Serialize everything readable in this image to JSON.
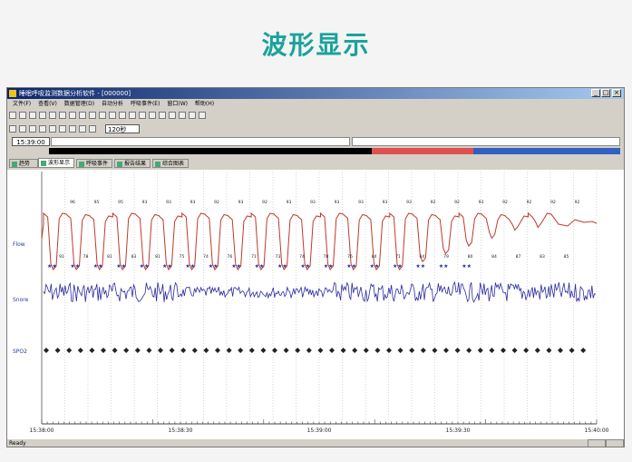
{
  "heading": "波形显示",
  "window": {
    "title": "睡眠呼吸监测数据分析软件 - [000000]",
    "menu": [
      "文件(F)",
      "查看(V)",
      "数据管理(D)",
      "自动分析",
      "呼吸事件(E)",
      "窗口(W)",
      "帮助(H)"
    ],
    "time": "15:39:00",
    "speed": "120秒",
    "tabs": [
      "趋势图",
      "波形显示",
      "呼吸事件",
      "报告结果",
      "综合图表"
    ],
    "active_tab": 1,
    "status": "Ready"
  },
  "channels": [
    "Flow",
    "Snore",
    "SPO2"
  ],
  "spo2_top_values": [
    "96",
    "95",
    "95",
    "93",
    "93",
    "93",
    "92",
    "93",
    "92",
    "93",
    "93",
    "93",
    "93",
    "93",
    "93",
    "92",
    "92",
    "93",
    "92",
    "92",
    "92",
    "92"
  ],
  "spo2_bottom_values": [
    "91",
    "78",
    "81",
    "83",
    "81",
    "75",
    "74",
    "76",
    "71",
    "73",
    "74",
    "78",
    "76",
    "84",
    "71",
    "84",
    "79",
    "80",
    "84",
    "87",
    "83",
    "85"
  ],
  "time_axis": [
    "15:38:00",
    "15:38:30",
    "15:39:00",
    "15:39:30",
    "15:40:00"
  ],
  "colors": {
    "heading": "#1aa39c",
    "flow": "#c0392b",
    "snore": "#2a2aa0",
    "star": "#2030a0",
    "spo2": "#222222",
    "bar_black": "#000000",
    "bar_red": "#e05050",
    "bar_blue": "#3060c0"
  }
}
